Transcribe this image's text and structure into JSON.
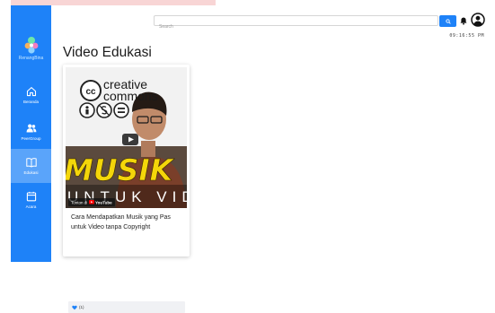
{
  "colors": {
    "sidebar": "#1e82f8",
    "sidebar_active": "#5aa4fa",
    "top_accent": "#f8d5d5",
    "like_heart": "#1e82f8"
  },
  "sidebar": {
    "logo_text": "RenangBina",
    "items": [
      {
        "label": "Beranda",
        "icon": "home-icon",
        "active": false
      },
      {
        "label": "PeerGroup",
        "icon": "users-icon",
        "active": false
      },
      {
        "label": "Edukasi",
        "icon": "book-open-icon",
        "active": true
      },
      {
        "label": "Acara",
        "icon": "calendar-icon",
        "active": false
      }
    ]
  },
  "header": {
    "search_placeholder": "Search",
    "search_icon": "search-icon",
    "notification_icon": "bell-icon",
    "profile_icon": "user-circle-icon",
    "datetime": "09:16:55 PM"
  },
  "main": {
    "title": "Video Edukasi",
    "videos": [
      {
        "title": "Cara Mendapatkan Musik yang Pas untuk Video tanpa Copyright",
        "likes": "(1)",
        "thumbnail": {
          "brand_lines": [
            "creative",
            "commons"
          ],
          "cc_badge": "cc",
          "big_word": "MUSIK",
          "sub_word": "UNTUK VID",
          "watch_on": "Tonton di",
          "youtube": "YouTube"
        }
      }
    ]
  }
}
